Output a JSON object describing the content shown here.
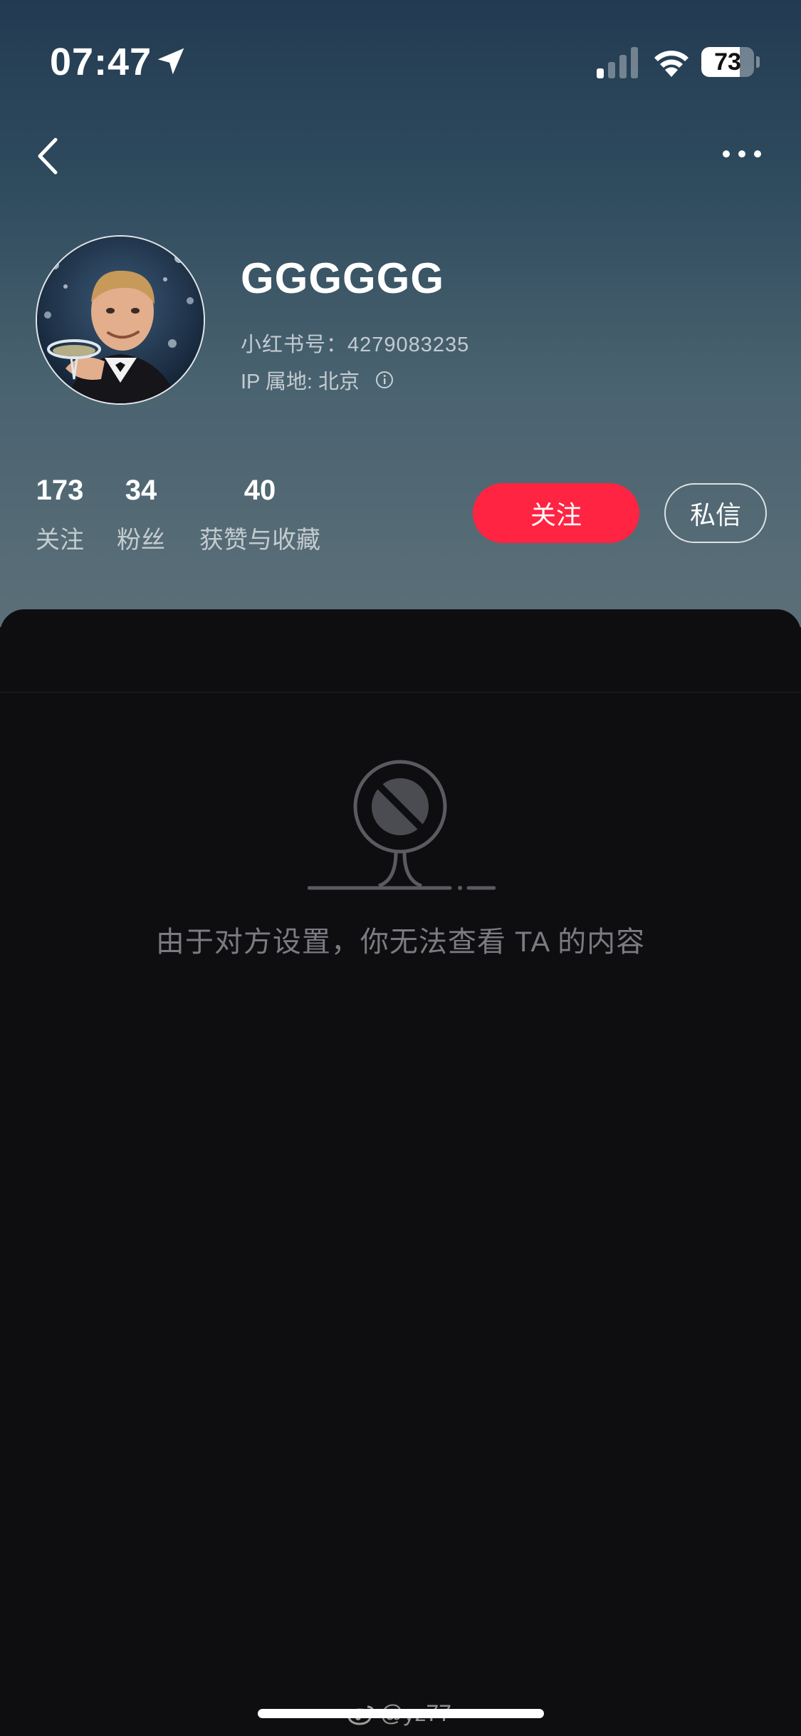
{
  "status_bar": {
    "time": "07:47",
    "battery": "73",
    "battery_level": 0.73
  },
  "nav": {
    "back_icon": "chevron-left-icon",
    "more_icon": "more-dots-icon"
  },
  "profile": {
    "username": "GGGGGG",
    "redbook_id": "小红书号：4279083235",
    "ip_location": "IP 属地: 北京"
  },
  "stats": [
    {
      "value": "173",
      "label": "关注"
    },
    {
      "value": "34",
      "label": "粉丝"
    },
    {
      "value": "40",
      "label": "获赞与收藏"
    }
  ],
  "actions": {
    "follow_label": "关注",
    "message_label": "私信"
  },
  "content": {
    "empty_message": "由于对方设置，你无法查看 TA 的内容"
  },
  "watermark": "@yz77",
  "colors": {
    "accent": "#ff2442",
    "panel_background": "#0e0e10"
  }
}
